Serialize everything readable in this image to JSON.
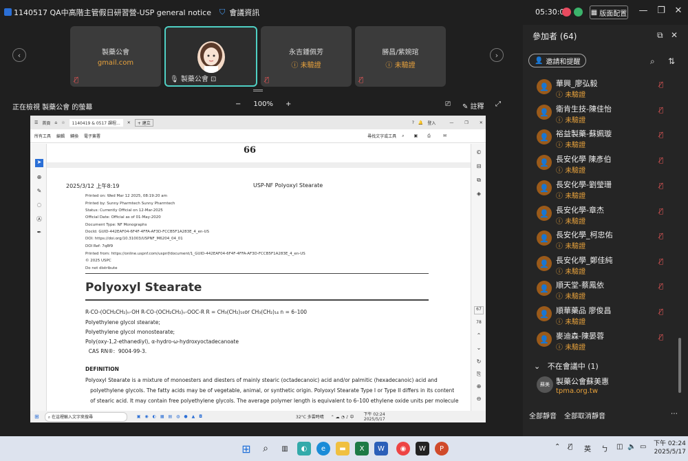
{
  "titlebar": {
    "meeting_title": "1140517 QA中高階主管假日研習營-USP general notice",
    "info_label": "會議資訊",
    "time": "05:30:02",
    "layout_label": "版面配置"
  },
  "thumbnails": [
    {
      "name": "製藥公會",
      "sub": "gmail.com"
    },
    {
      "name": "",
      "sub": "",
      "label": "製藥公會"
    },
    {
      "name": "永吉鍾佩芳",
      "sub": "未驗證"
    },
    {
      "name": "勝昌/紫婉琯",
      "sub": "未驗證"
    }
  ],
  "viewbar": {
    "viewing_label": "正在檢視 製藥公會 的螢幕",
    "zoom": "100%",
    "note_label": "註釋"
  },
  "pdf": {
    "tab1": "首頁",
    "tab2": "1140419 & 0517 課程...",
    "tab_new": "+ 建立",
    "signin": "登入",
    "menu": [
      "所有工具",
      "編輯",
      "轉換",
      "電子簽署"
    ],
    "search_tools": "尋找文字或工具",
    "page_marker": "66",
    "date": "2025/3/12 上午8:19",
    "header": "USP-NF Polyoxyl Stearate",
    "meta": [
      "Printed on: Wed Mar 12 2025, 08:19:20 am",
      "Printed by: Sunny Pharmtech Sunny Pharmtech",
      "Status: Currently Official on 12-Mar-2025",
      "Official Date: Official as of 01-May-2020",
      "Document Type: NF Monographs",
      "DocId: GUID-442EAF04-6F4F-4FFA-AF3D-FCCB5F1A283E_4_en-US",
      "DOI: https://doi.org/10.31003/USPNF_M6204_04_01",
      "DOI Ref: 7q8f9",
      "Printed from: https://online.uspnf.com/uspnf/document/1_GUID-442EAF04-6F4F-4FFA-AF3D-FCCB5F1A283E_4_en-US",
      "© 2025 USPC",
      "Do not distribute"
    ],
    "title": "Polyoxyl Stearate",
    "formula": "R-CO-(OCH₂CH₂)ₙ-OH R-CO-(OCH₂CH₂)ₙ-OOC-R R = CH₃(CH₂)₁₆or CH₃(CH₂)₁₄ n = 6–100",
    "names": [
      "Polyethylene glycol stearate;",
      "Polyethylene glycol monostearate;",
      "Poly(oxy-1,2-ethanediyl), α-hydro-ω-hydroxyoctadecanoate",
      "  CAS RN®:  9004-99-3."
    ],
    "def_head": "DEFINITION",
    "def_lines": [
      "Polyoxyl Stearate is a mixture of monoesters and diesters of mainly stearic (octadecanoic) acid and/or palmitic (hexadecanoic) acid and",
      "   polyethylene glycols. The fatty acids may be of vegetable, animal, or synthetic origin. Polyoxyl Stearate Type I or Type II differs in its content",
      "   of stearic acid. It may contain free polyethylene glycols. The average polymer length is equivalent to 6–100 ethylene oxide units per molecule"
    ],
    "page_nums": [
      "67",
      "78"
    ],
    "taskbar_search": "在這裡輸入文字來搜尋",
    "weather": "32°C  多雲時晴",
    "clock_time": "下午 02:24",
    "clock_date": "2025/5/17"
  },
  "panel": {
    "title": "參加者 (64)",
    "invite_label": "邀請和提醒",
    "participants": [
      {
        "name": "華興_廖弘毅",
        "status": "未驗證"
      },
      {
        "name": "衛肯生技-陳佳怡",
        "status": "未驗證"
      },
      {
        "name": "裕益製藥-蘇姵璇",
        "status": "未驗證"
      },
      {
        "name": "長安化學 陳彥伯",
        "status": "未驗證"
      },
      {
        "name": "長安化學-劉瑩珊",
        "status": "未驗證"
      },
      {
        "name": "長安化學-章杰",
        "status": "未驗證"
      },
      {
        "name": "長安化學_柯忠佑",
        "status": "未驗證"
      },
      {
        "name": "長安化學_鄭佳純",
        "status": "未驗證"
      },
      {
        "name": "順天堂-蔡鳳依",
        "status": "未驗證"
      },
      {
        "name": "順華藥品 廖俊昌",
        "status": "未驗證"
      },
      {
        "name": "麥迪森-陳晏蓉",
        "status": "未驗證"
      }
    ],
    "absent_header": "不在會議中 (1)",
    "absent_name": "製藥公會蘇美惠",
    "absent_sub": "tpma.org.tw",
    "absent_avatar": "蘇美",
    "mute_all": "全部靜音",
    "unmute_all": "全部取消靜音"
  },
  "taskbar": {
    "ime": "英",
    "time": "下午 02:24",
    "date": "2025/5/17"
  }
}
